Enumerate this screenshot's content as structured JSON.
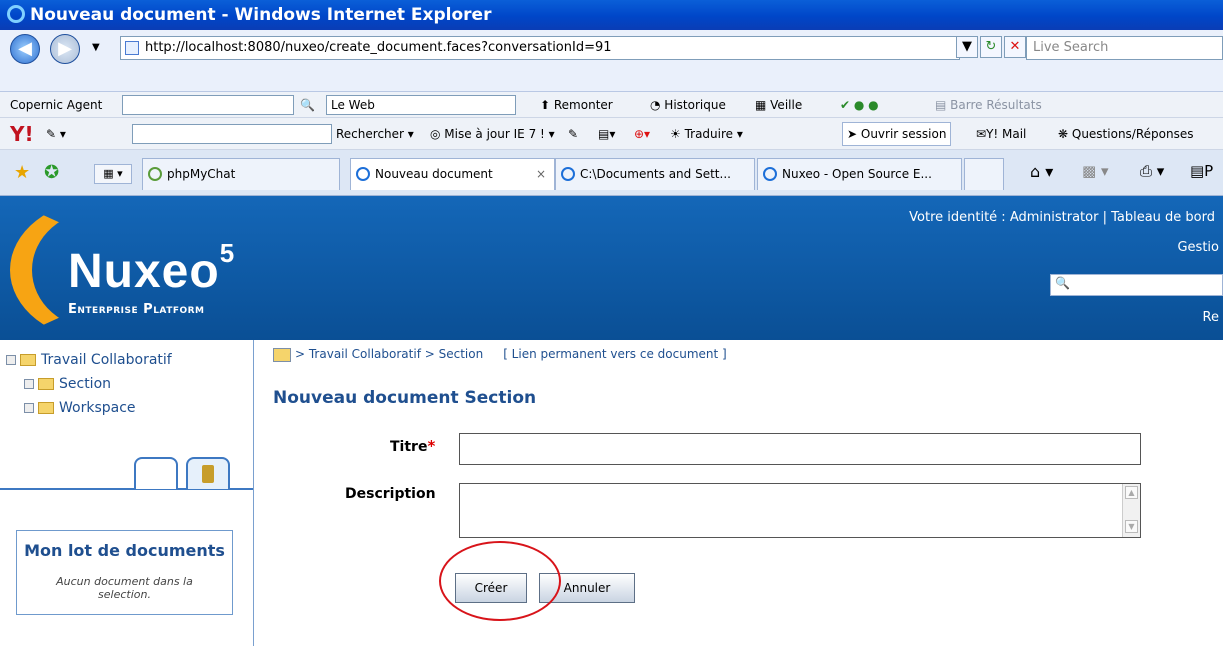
{
  "window": {
    "title": "Nouveau document - Windows Internet Explorer"
  },
  "address_bar": {
    "url": "http://localhost:8080/nuxeo/create_document.faces?conversationId=91",
    "search_placeholder": "Live Search"
  },
  "toolbar1": {
    "copernic_label": "Copernic Agent",
    "le_web": "Le Web",
    "remonter": "Remonter",
    "historique": "Historique",
    "veille": "Veille",
    "barre_resultats": "Barre Résultats"
  },
  "toolbar2": {
    "yahoo": "Y!",
    "rechercher": "Rechercher",
    "mise_a_jour": "Mise à jour IE 7 !",
    "traduire": "Traduire",
    "ouvrir_session": "Ouvrir session",
    "ymail": "Y! Mail",
    "questions": "Questions/Réponses"
  },
  "tabs": [
    {
      "label": "phpMyChat"
    },
    {
      "label": "Nouveau document",
      "close": "×"
    },
    {
      "label": "C:\\Documents and Sett..."
    },
    {
      "label": "Nuxeo - Open Source E..."
    }
  ],
  "header": {
    "logo": "Nuxeo",
    "logo_sup": "5",
    "logo_sub": "Enterprise Platform",
    "identity": "Votre identité : Administrator | Tableau de bord",
    "gestio": "Gestio",
    "re": "Re"
  },
  "tree": {
    "root": "Travail Collaboratif",
    "items": [
      {
        "label": "Section"
      },
      {
        "label": "Workspace"
      }
    ]
  },
  "lot": {
    "title": "Mon lot de documents",
    "message": "Aucun document dans la selection."
  },
  "breadcrumb": {
    "path": "> Travail Collaboratif > Section",
    "permalink": "[ Lien permanent vers ce document ]"
  },
  "form": {
    "title": "Nouveau document Section",
    "titre_label": "Titre",
    "required_mark": "*",
    "description_label": "Description",
    "titre_value": "",
    "description_value": "",
    "create_button": "Créer",
    "cancel_button": "Annuler"
  }
}
